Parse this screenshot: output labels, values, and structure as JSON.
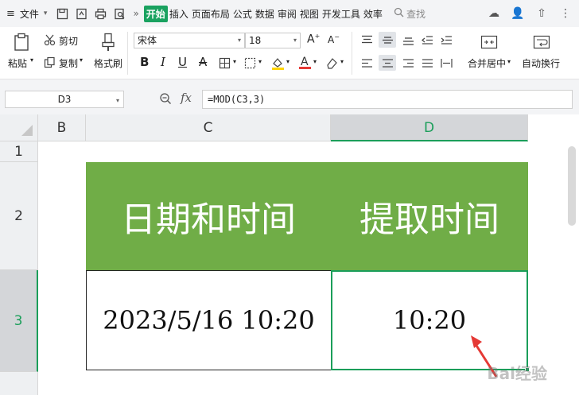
{
  "menubar": {
    "file_label": "文件",
    "tabs": [
      {
        "label": "开始",
        "active": true
      },
      {
        "label": "插入",
        "active": false
      },
      {
        "label": "页面布局",
        "active": false
      },
      {
        "label": "公式",
        "active": false
      },
      {
        "label": "数据",
        "active": false
      },
      {
        "label": "审阅",
        "active": false
      },
      {
        "label": "视图",
        "active": false
      },
      {
        "label": "开发工具",
        "active": false
      },
      {
        "label": "效率",
        "active": false
      }
    ],
    "search_label": "查找"
  },
  "ribbon": {
    "paste_label": "粘贴",
    "cut_label": "剪切",
    "copy_label": "复制",
    "format_painter_label": "格式刷",
    "font_name": "宋体",
    "font_size": "18",
    "merge_label": "合并居中",
    "wrap_label": "自动换行"
  },
  "formula_bar": {
    "name_box": "D3",
    "fx_label": "fx",
    "formula": "=MOD(C3,3)"
  },
  "grid": {
    "columns": [
      "B",
      "C",
      "D"
    ],
    "rows": [
      "1",
      "2",
      "3"
    ],
    "selected_column": "D",
    "selected_row": "3",
    "header_c": "日期和时间",
    "header_d": "提取时间",
    "c3": "2023/5/16 10:20",
    "d3": "10:20"
  },
  "colors": {
    "accent": "#1b9e5a",
    "header_fill": "#70ad47"
  },
  "watermark": "Bai经验"
}
